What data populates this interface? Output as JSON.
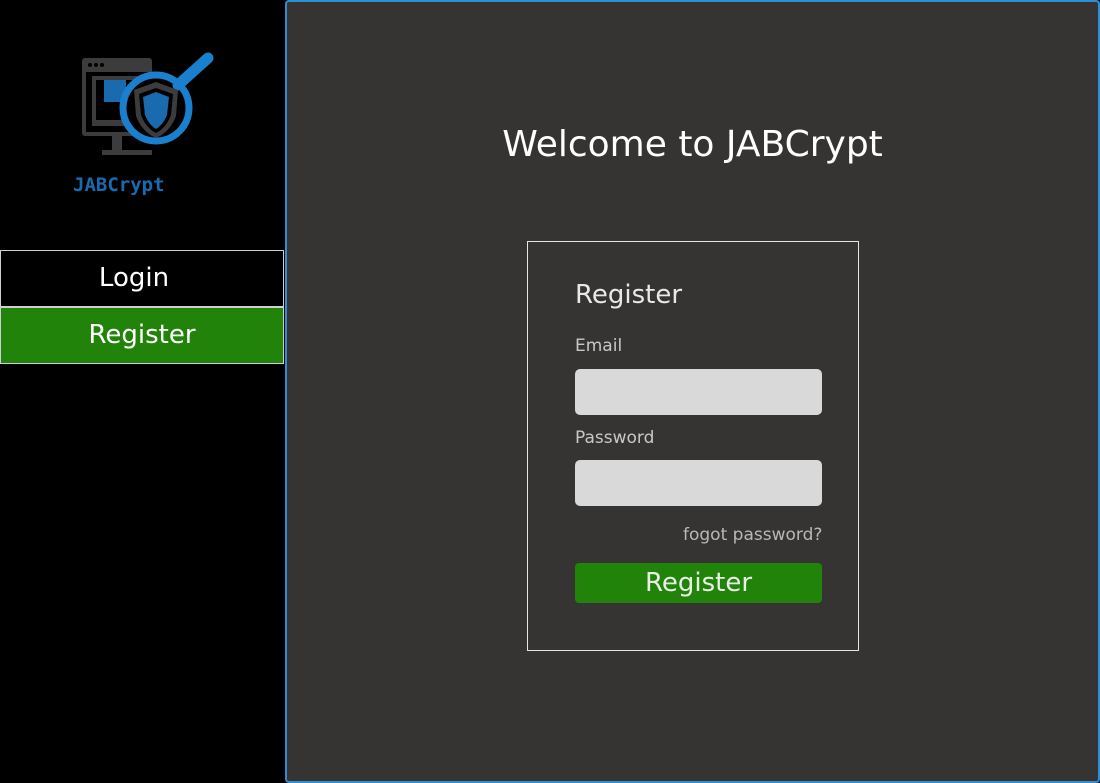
{
  "brand": {
    "name": "JABCrypt",
    "logo_icon": "monitor-magnifier-shield-icon",
    "logo_color": "#1a6ab0"
  },
  "sidebar": {
    "items": [
      {
        "label": "Login",
        "active": false
      },
      {
        "label": "Register",
        "active": true
      }
    ],
    "active_color": "#22830a"
  },
  "main": {
    "welcome": "Welcome to JABCrypt",
    "accent_border": "#2e8fd6"
  },
  "form": {
    "title": "Register",
    "email_label": "Email",
    "email_value": "",
    "password_label": "Password",
    "password_value": "",
    "forgot_link": "fogot password?",
    "submit_label": "Register"
  }
}
